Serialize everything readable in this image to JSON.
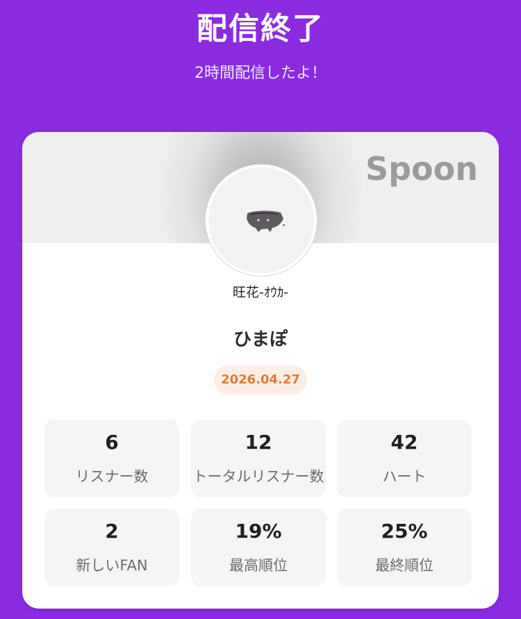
{
  "header": {
    "title": "配信終了",
    "subtitle": "2時間配信したよ！"
  },
  "card": {
    "brand": "Spoon",
    "artist_name": "旺花-ｵｳｶ-",
    "stream_title": "ひまぽ",
    "date": "2026.04.27",
    "accent_color": "#e07a36",
    "background_color": "#8a2be2"
  },
  "stats": [
    {
      "value": "6",
      "label": "リスナー数"
    },
    {
      "value": "12",
      "label": "トータルリスナー数"
    },
    {
      "value": "42",
      "label": "ハート"
    },
    {
      "value": "2",
      "label": "新しいFAN"
    },
    {
      "value": "19%",
      "label": "最高順位"
    },
    {
      "value": "25%",
      "label": "最終順位"
    }
  ]
}
